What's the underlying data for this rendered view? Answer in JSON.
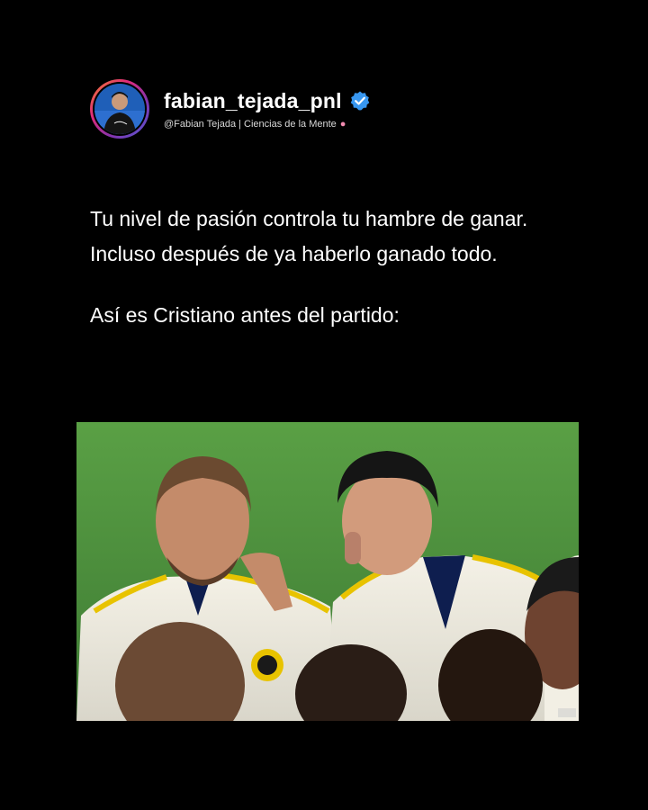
{
  "post": {
    "username": "fabian_tejada_pnl",
    "verified": true,
    "subtitle": "@Fabian Tejada | Ciencias de la Mente",
    "subtitle_emoji": "brain-icon",
    "paragraphs": [
      "Tu nivel de pasión controla tu hambre de ganar. Incluso después de ya haberlo ganado todo.",
      "Así es Cristiano antes del partido:"
    ],
    "avatar_signature": "Fabian Tejada"
  },
  "colors": {
    "background": "#000000",
    "text": "#ffffff",
    "verified_badge": "#3897f0",
    "pitch_green": "#4b8a3d"
  },
  "icons": {
    "verified": "verified-badge-icon",
    "brain": "brain-icon"
  }
}
